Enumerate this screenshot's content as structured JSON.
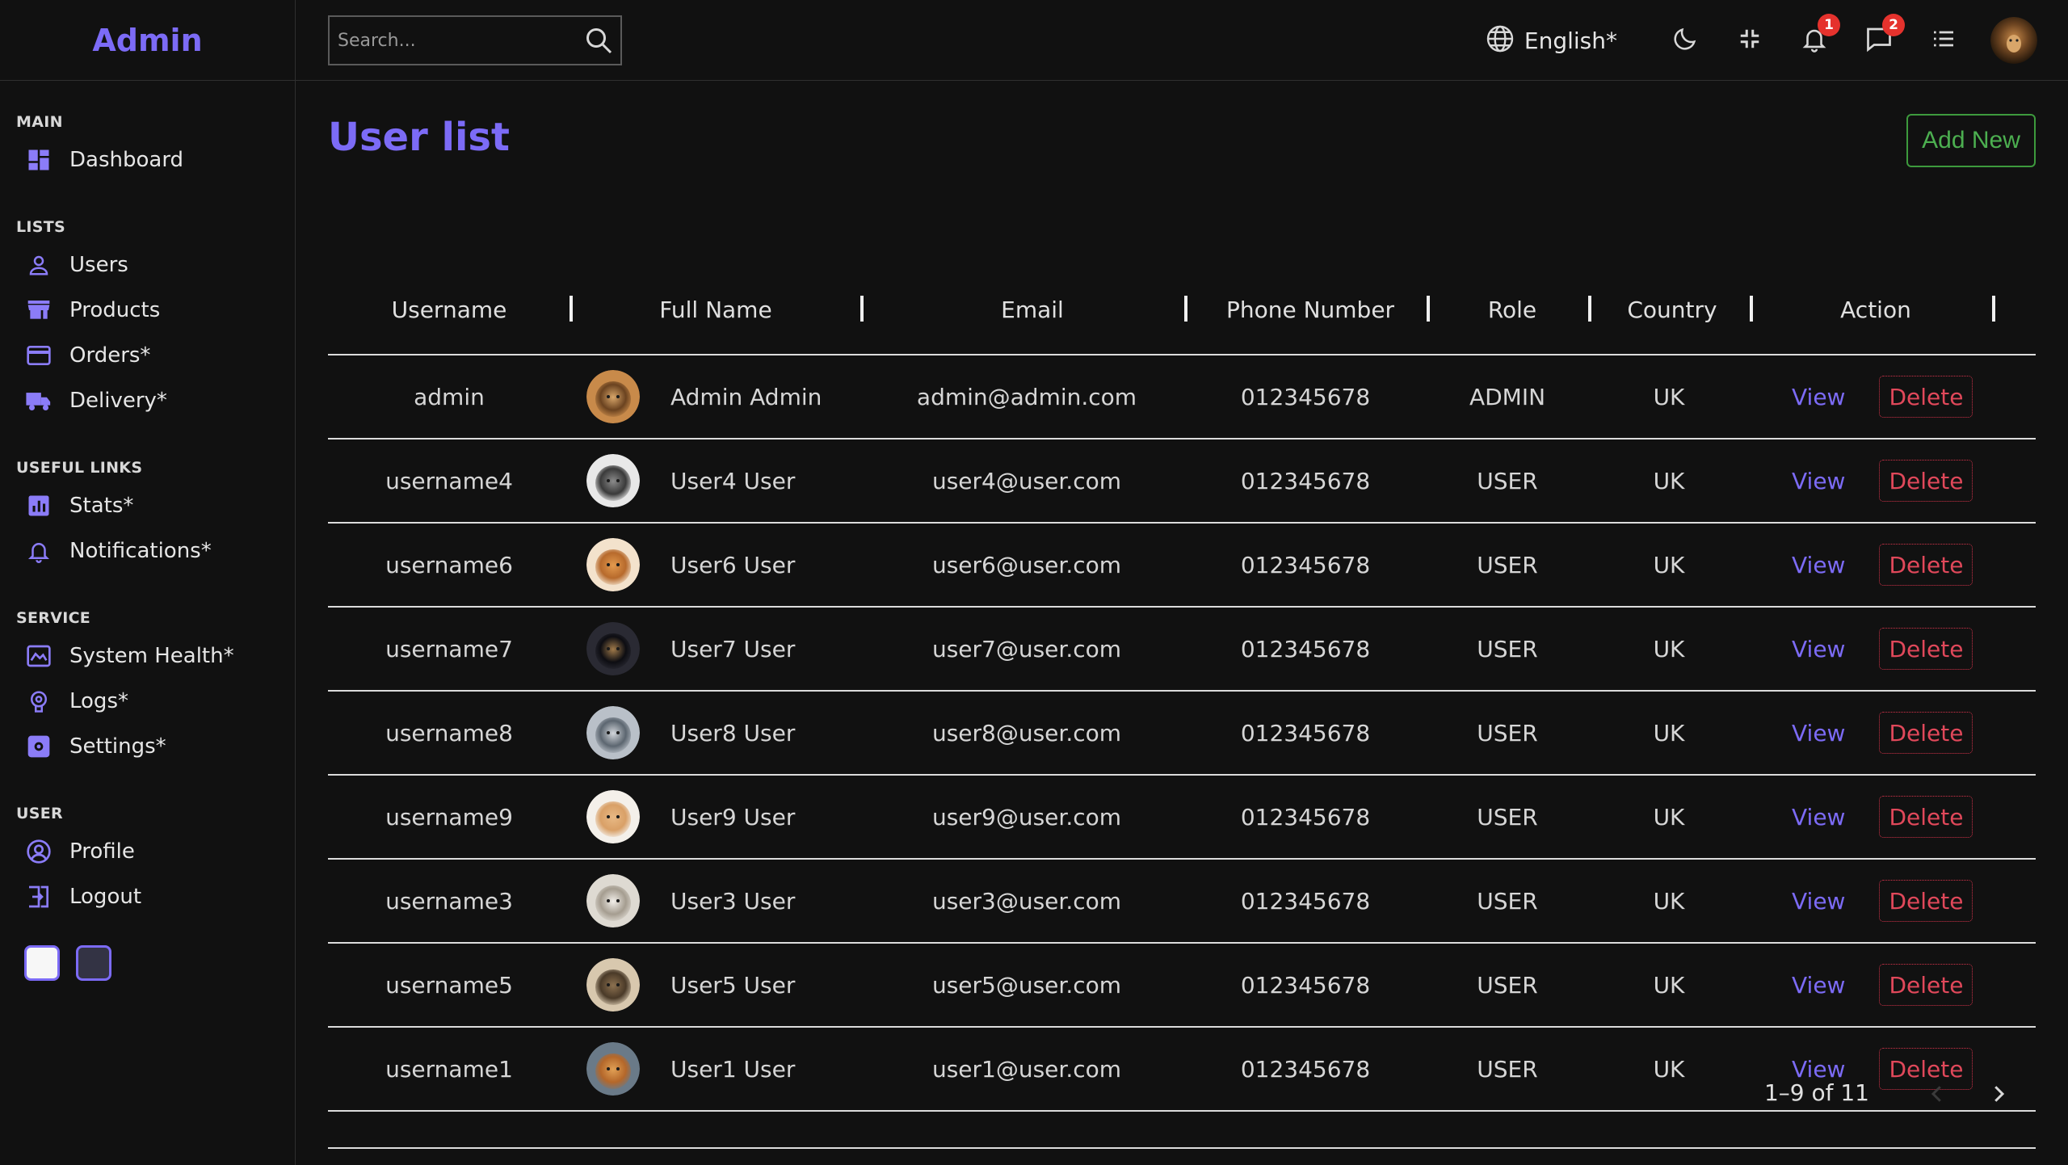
{
  "app": {
    "logo": "Admin"
  },
  "sidebar": {
    "sections": [
      {
        "title": "MAIN",
        "items": [
          {
            "label": "Dashboard",
            "icon": "dashboard-icon"
          }
        ]
      },
      {
        "title": "LISTS",
        "items": [
          {
            "label": "Users",
            "icon": "user-icon"
          },
          {
            "label": "Products",
            "icon": "store-icon"
          },
          {
            "label": "Orders*",
            "icon": "credit-card-icon"
          },
          {
            "label": "Delivery*",
            "icon": "truck-icon"
          }
        ]
      },
      {
        "title": "USEFUL LINKS",
        "items": [
          {
            "label": "Stats*",
            "icon": "chart-icon"
          },
          {
            "label": "Notifications*",
            "icon": "bell-icon"
          }
        ]
      },
      {
        "title": "SERVICE",
        "items": [
          {
            "label": "System Health*",
            "icon": "health-icon"
          },
          {
            "label": "Logs*",
            "icon": "brain-icon"
          },
          {
            "label": "Settings*",
            "icon": "settings-icon"
          }
        ]
      },
      {
        "title": "USER",
        "items": [
          {
            "label": "Profile",
            "icon": "profile-icon"
          },
          {
            "label": "Logout",
            "icon": "logout-icon"
          }
        ]
      }
    ]
  },
  "topbar": {
    "search_placeholder": "Search...",
    "language": "English*",
    "notifications_count": "1",
    "messages_count": "2"
  },
  "main": {
    "title": "User list",
    "add_new_label": "Add New"
  },
  "table": {
    "columns": [
      "Username",
      "Full Name",
      "Email",
      "Phone Number",
      "Role",
      "Country",
      "Action"
    ],
    "view_label": "View",
    "delete_label": "Delete",
    "rows": [
      {
        "username": "admin",
        "full_name": "Admin Admin",
        "email": "admin@admin.com",
        "phone": "012345678",
        "role": "ADMIN",
        "country": "UK",
        "avatar": "lion"
      },
      {
        "username": "username4",
        "full_name": "User4 User",
        "email": "user4@user.com",
        "phone": "012345678",
        "role": "USER",
        "country": "UK",
        "avatar": "cat-dark"
      },
      {
        "username": "username6",
        "full_name": "User6 User",
        "email": "user6@user.com",
        "phone": "012345678",
        "role": "USER",
        "country": "UK",
        "avatar": "cat-orange"
      },
      {
        "username": "username7",
        "full_name": "User7 User",
        "email": "user7@user.com",
        "phone": "012345678",
        "role": "USER",
        "country": "UK",
        "avatar": "cat-night"
      },
      {
        "username": "username8",
        "full_name": "User8 User",
        "email": "user8@user.com",
        "phone": "012345678",
        "role": "USER",
        "country": "UK",
        "avatar": "cat-grey"
      },
      {
        "username": "username9",
        "full_name": "User9 User",
        "email": "user9@user.com",
        "phone": "012345678",
        "role": "USER",
        "country": "UK",
        "avatar": "cat-ginger"
      },
      {
        "username": "username3",
        "full_name": "User3 User",
        "email": "user3@user.com",
        "phone": "012345678",
        "role": "USER",
        "country": "UK",
        "avatar": "cat-white"
      },
      {
        "username": "username5",
        "full_name": "User5 User",
        "email": "user5@user.com",
        "phone": "012345678",
        "role": "USER",
        "country": "UK",
        "avatar": "cat-tabby"
      },
      {
        "username": "username1",
        "full_name": "User1 User",
        "email": "user1@user.com",
        "phone": "012345678",
        "role": "USER",
        "country": "UK",
        "avatar": "cat-orange-tabby"
      }
    ]
  },
  "pagination": {
    "label": "1–9 of 11"
  },
  "colors": {
    "accent": "#7c6bf6",
    "success": "#4caf50",
    "danger": "#e0485a",
    "badge": "#e5322d",
    "background": "#111111"
  }
}
